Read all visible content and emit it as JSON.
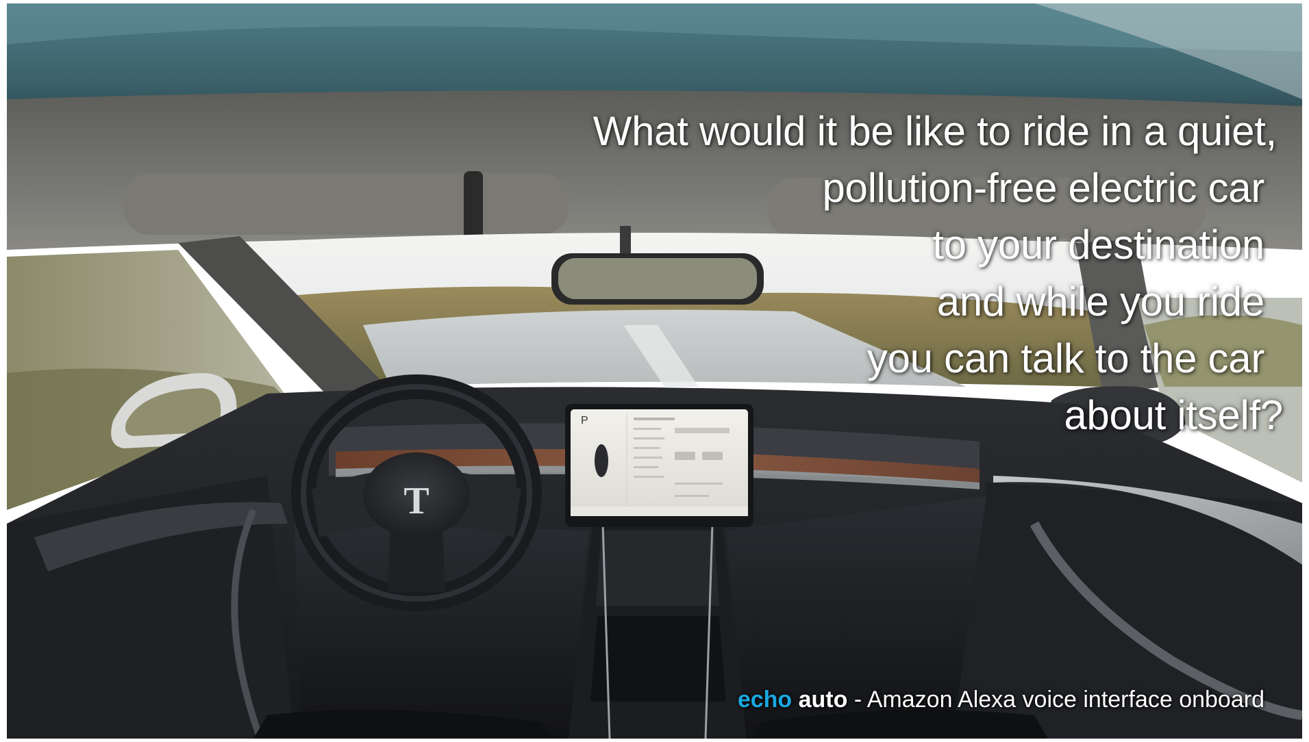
{
  "image": {
    "subject": "photo-interior-of-electric-car",
    "colors": {
      "caption_brand": "#1aa7e0",
      "text": "#ffffff"
    }
  },
  "headline": {
    "lines": [
      "What would it be like to ride in a quiet,",
      "pollution-free electric car",
      "to your destination",
      "and while you ride",
      "you can talk to the car",
      "about itself?"
    ]
  },
  "caption": {
    "brand_first": "echo",
    "brand_second": "auto",
    "rest": " - Amazon Alexa voice interface onboard"
  },
  "screen": {
    "gear": "P"
  }
}
